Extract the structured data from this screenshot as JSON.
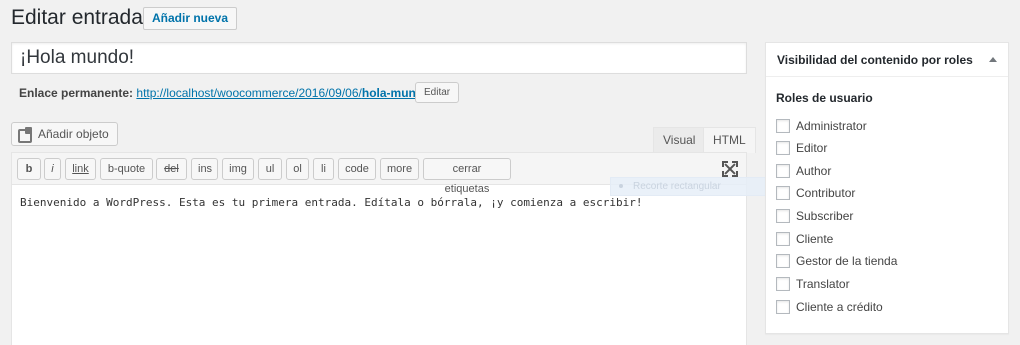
{
  "header": {
    "title": "Editar entrada",
    "add_new_label": "Añadir nueva"
  },
  "post": {
    "title_value": "¡Hola mundo!",
    "permalink_label": "Enlace permanente:",
    "permalink_base": "http://localhost/woocommerce/2016/09/06/",
    "permalink_slug": "hola-mundo",
    "permalink_trailing": "/",
    "edit_slug_label": "Editar"
  },
  "editor": {
    "add_media_label": "Añadir objeto",
    "tabs": {
      "visual": "Visual",
      "html": "HTML"
    },
    "quicktags": [
      "b",
      "i",
      "link",
      "b-quote",
      "del",
      "ins",
      "img",
      "ul",
      "ol",
      "li",
      "code",
      "more",
      "cerrar etiquetas"
    ],
    "content": "Bienvenido a WordPress. Esta es tu primera entrada. Edítala o bórrala, ¡y comienza a escribir!",
    "ghost_tooltip": "Recorte rectangular"
  },
  "sidebar": {
    "box_title": "Visibilidad del contenido por roles",
    "roles_heading": "Roles de usuario",
    "roles": [
      "Administrator",
      "Editor",
      "Author",
      "Contributor",
      "Subscriber",
      "Cliente",
      "Gestor de la tienda",
      "Translator",
      "Cliente a crédito"
    ]
  },
  "colors": {
    "link": "#0073aa",
    "background": "#f1f1f1"
  },
  "icons": {
    "add_media": "media-icon",
    "fullscreen": "fullscreen-icon",
    "toggle": "arrow-up-icon"
  }
}
